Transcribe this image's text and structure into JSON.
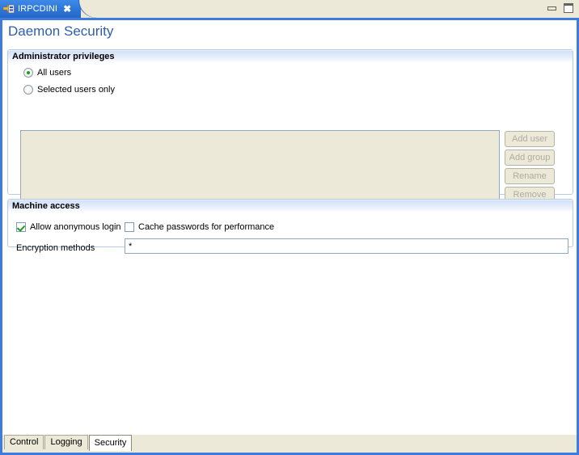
{
  "window": {
    "tab": {
      "title": "IRPCDINI",
      "icon": "file-config-icon",
      "close_label": "✖"
    },
    "controls": {
      "minimize": "minimize-button",
      "maximize": "maximize-button"
    }
  },
  "page": {
    "title": "Daemon Security"
  },
  "sections": {
    "admin": {
      "header": "Administrator privileges",
      "radios": [
        {
          "label": "All users",
          "checked": true
        },
        {
          "label": "Selected users only",
          "checked": false
        }
      ],
      "list": {
        "items": [],
        "enabled": false
      },
      "buttons": [
        {
          "label": "Add user",
          "enabled": false
        },
        {
          "label": "Add group",
          "enabled": false
        },
        {
          "label": "Rename",
          "enabled": false
        },
        {
          "label": "Remove",
          "enabled": false
        }
      ]
    },
    "machine": {
      "header": "Machine access",
      "checkboxes": [
        {
          "label": "Allow anonymous login",
          "checked": true
        },
        {
          "label": "Cache passwords for performance",
          "checked": false
        }
      ],
      "encryption": {
        "label": "Encryption methods",
        "value": "*",
        "placeholder": ""
      }
    }
  },
  "bottom_tabs": [
    {
      "label": "Control",
      "active": false
    },
    {
      "label": "Logging",
      "active": false
    },
    {
      "label": "Security",
      "active": true
    }
  ],
  "colors": {
    "accent_border": "#3d7bde",
    "title_text": "#2f5ea8",
    "chrome": "#ece9d8",
    "check_green": "#1f9b1f"
  }
}
